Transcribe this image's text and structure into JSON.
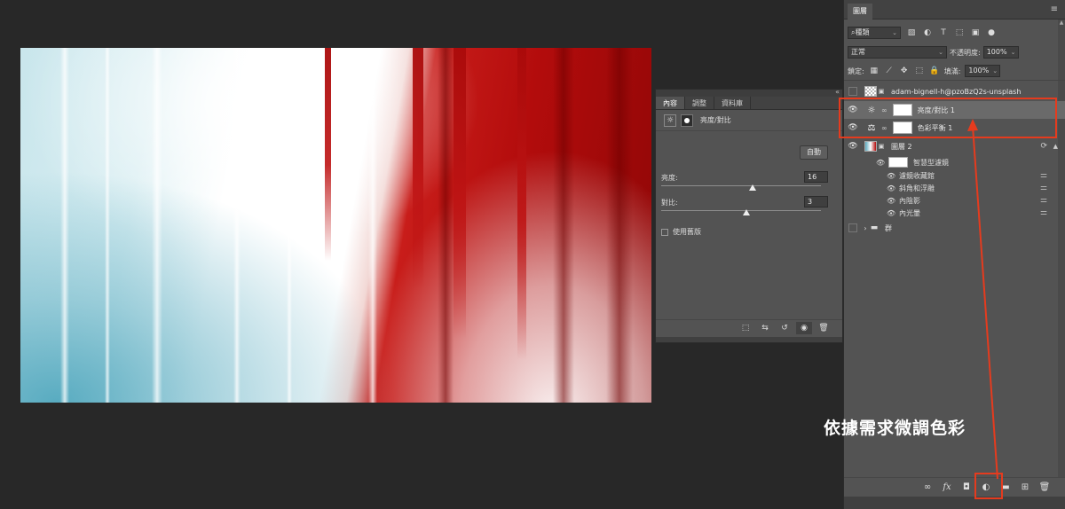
{
  "properties_panel": {
    "tabs": [
      "內容",
      "調整",
      "資料庫"
    ],
    "active_tab": "內容",
    "adjustment_title": "亮度/對比",
    "auto_button": "自動",
    "brightness": {
      "label": "亮度:",
      "value": "16"
    },
    "contrast": {
      "label": "對比:",
      "value": "3"
    },
    "legacy_checkbox": {
      "label": "使用舊版",
      "checked": false
    }
  },
  "layers_panel": {
    "tab_title": "圖層",
    "filter_kind": "種類",
    "blend_mode": "正常",
    "opacity_label": "不透明度:",
    "opacity_value": "100%",
    "lock_label": "鎖定:",
    "fill_label": "填滿:",
    "fill_value": "100%",
    "layers": [
      {
        "name": "adam-bignell-h@pzoBzQ2s-unsplash",
        "visible": false,
        "type": "pixel"
      },
      {
        "name": "亮度/對比 1",
        "visible": true,
        "type": "adjustment",
        "selected": true
      },
      {
        "name": "色彩平衡 1",
        "visible": true,
        "type": "adjustment"
      },
      {
        "name": "圖層 2",
        "visible": true,
        "type": "smart-object"
      }
    ],
    "smart_filters": {
      "label": "智慧型濾鏡",
      "items": [
        "濾鏡收藏館",
        "斜角和浮雕",
        "內陰影",
        "內光暈"
      ]
    },
    "group": {
      "name": "群",
      "visible": false
    }
  },
  "annotation": {
    "text": "依據需求微調色彩",
    "color": "#e53b1e"
  }
}
